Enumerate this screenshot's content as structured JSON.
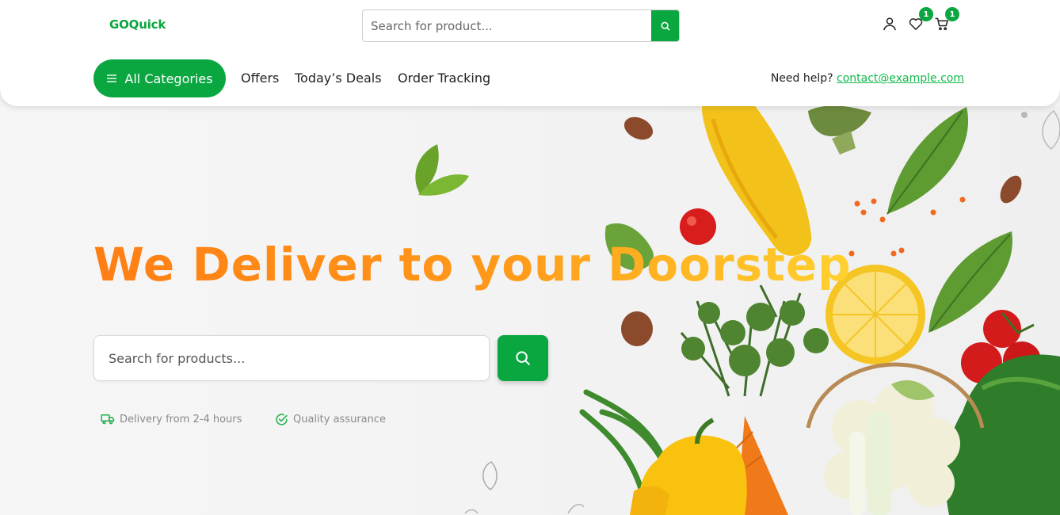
{
  "brand": {
    "name": "GOQuick",
    "color": "#0aa640"
  },
  "header": {
    "search": {
      "placeholder": "Search for product..."
    },
    "icons": [
      {
        "name": "user-icon"
      },
      {
        "name": "heart-icon",
        "badge": "1"
      },
      {
        "name": "cart-icon",
        "badge": "1"
      }
    ]
  },
  "nav": {
    "all_categories": "All Categories",
    "links": [
      "Offers",
      "Today’s Deals",
      "Order Tracking"
    ],
    "help_text": "Need help?",
    "help_email": "contact@example.com"
  },
  "hero": {
    "headline": "We Deliver to your Doorstep",
    "search_placeholder": "Search for products...",
    "features": [
      {
        "icon": "truck-icon",
        "label": "Delivery from 2-4 hours"
      },
      {
        "icon": "check-circle-icon",
        "label": "Quality assurance"
      }
    ]
  },
  "colors": {
    "accent": "#0aa640",
    "link": "#12b94a",
    "headline_start": "#ff7e14",
    "headline_end": "#ffd12e"
  }
}
